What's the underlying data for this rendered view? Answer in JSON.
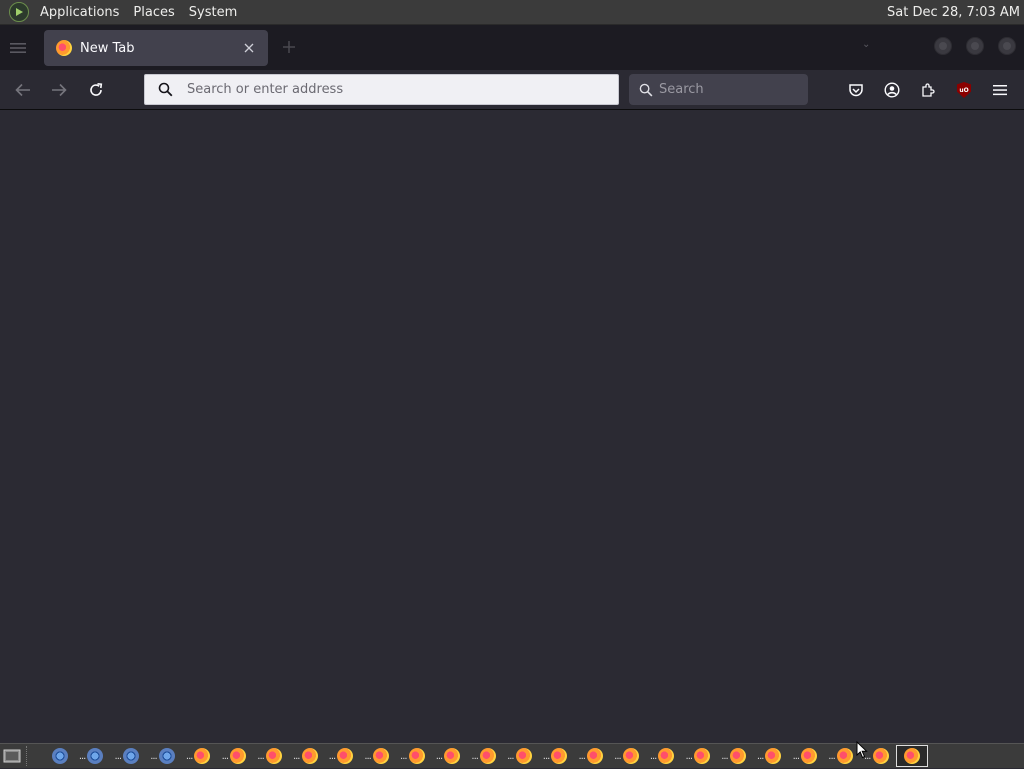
{
  "top_panel": {
    "menus": [
      "Applications",
      "Places",
      "System"
    ],
    "clock": "Sat Dec 28,  7:03 AM"
  },
  "browser": {
    "tab": {
      "title": "New Tab",
      "icon": "firefox-icon"
    },
    "urlbar": {
      "placeholder": "Search or enter address",
      "value": ""
    },
    "searchbar": {
      "placeholder": "Search",
      "value": ""
    },
    "toolbar_icons": [
      "pocket-icon",
      "account-icon",
      "extensions-icon",
      "ublock-origin-icon",
      "menu-icon"
    ],
    "ublock_label": "uO"
  },
  "taskbar": {
    "items": [
      {
        "icon": "chrome-icon",
        "label": "..."
      },
      {
        "icon": "chrome-icon",
        "label": "..."
      },
      {
        "icon": "chrome-icon",
        "label": "..."
      },
      {
        "icon": "chrome-icon",
        "label": "..."
      },
      {
        "icon": "firefox-icon",
        "label": "..."
      },
      {
        "icon": "firefox-icon",
        "label": "..."
      },
      {
        "icon": "firefox-icon",
        "label": "..."
      },
      {
        "icon": "firefox-icon",
        "label": "..."
      },
      {
        "icon": "firefox-icon",
        "label": "..."
      },
      {
        "icon": "firefox-icon",
        "label": "..."
      },
      {
        "icon": "firefox-icon",
        "label": "..."
      },
      {
        "icon": "firefox-icon",
        "label": "..."
      },
      {
        "icon": "firefox-icon",
        "label": "..."
      },
      {
        "icon": "firefox-icon",
        "label": "..."
      },
      {
        "icon": "firefox-icon",
        "label": "..."
      },
      {
        "icon": "firefox-icon",
        "label": "..."
      },
      {
        "icon": "firefox-icon",
        "label": "..."
      },
      {
        "icon": "firefox-icon",
        "label": "..."
      },
      {
        "icon": "firefox-icon",
        "label": "..."
      },
      {
        "icon": "firefox-icon",
        "label": "..."
      },
      {
        "icon": "firefox-icon",
        "label": "..."
      },
      {
        "icon": "firefox-icon",
        "label": "..."
      },
      {
        "icon": "firefox-icon",
        "label": "..."
      },
      {
        "icon": "firefox-icon",
        "label": "..."
      }
    ],
    "active_item": {
      "icon": "firefox-icon"
    }
  },
  "colors": {
    "panel_bg": "#3b3b3b",
    "tabbar_bg": "#1c1b22",
    "toolbar_bg": "#2b2a33",
    "active_tab_bg": "#42414d",
    "urlbar_bg": "#f0f0f4",
    "content_bg": "#2b2a33"
  }
}
